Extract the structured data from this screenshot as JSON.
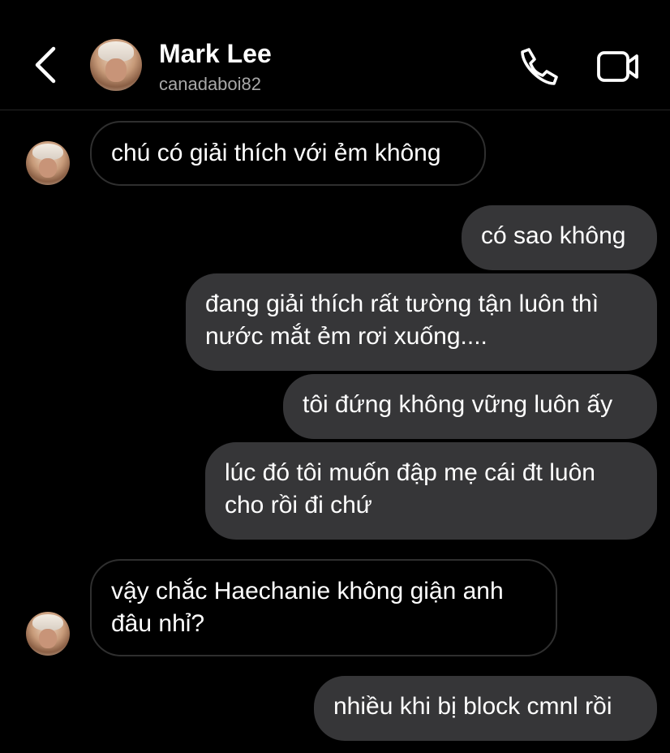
{
  "header": {
    "name": "Mark Lee",
    "handle": "canadaboi82",
    "icons": {
      "back": "chevron-left-icon",
      "call": "phone-icon",
      "video": "video-camera-icon"
    }
  },
  "colors": {
    "background": "#000000",
    "outgoing_bubble": "#363638",
    "incoming_border": "#2f2f2f",
    "handle_text": "#a8a8a8"
  },
  "messages": [
    {
      "direction": "incoming",
      "lines": [
        "chú có giải thích với ẻm không"
      ]
    },
    {
      "direction": "outgoing",
      "lines": [
        "có sao không"
      ]
    },
    {
      "direction": "outgoing",
      "lines": [
        "đang giải thích rất tường tận luôn thì",
        "nước mắt ẻm rơi xuống...."
      ]
    },
    {
      "direction": "outgoing",
      "lines": [
        "tôi đứng không vững luôn ấy"
      ]
    },
    {
      "direction": "outgoing",
      "lines": [
        "lúc đó tôi muốn đập mẹ cái đt luôn",
        "cho rồi đi chứ"
      ]
    },
    {
      "direction": "incoming",
      "lines": [
        "vậy chắc Haechanie không giận anh",
        "đâu nhỉ?"
      ]
    },
    {
      "direction": "outgoing",
      "lines": [
        "nhiều khi bị block cmnl rồi"
      ]
    }
  ]
}
